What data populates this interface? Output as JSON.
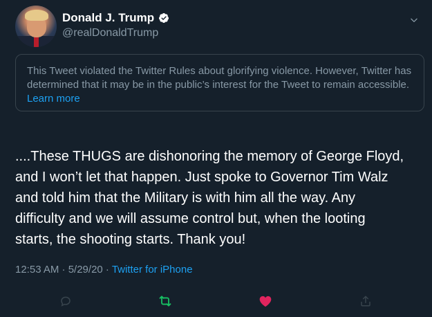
{
  "author": {
    "display_name": "Donald J. Trump",
    "handle": "@realDonaldTrump",
    "verified": true
  },
  "notice": {
    "text": "This Tweet violated the Twitter Rules about glorifying violence. However, Twitter has determined that it may be in the public’s interest for the Tweet to remain accessible. ",
    "link_label": "Learn more"
  },
  "tweet": {
    "text": "....These THUGS are dishonoring the memory of George Floyd,\nand I won’t let that happen. Just spoke to Governor Tim Walz\nand told him that the Military is with him all the way. Any\ndifficulty and we will assume control but, when the looting\nstarts, the shooting starts. Thank you!"
  },
  "meta": {
    "timestamp": "12:53 AM · 5/29/20 · ",
    "source": "Twitter for iPhone"
  },
  "colors": {
    "background": "#15202b",
    "text": "#ffffff",
    "secondary": "#8899a6",
    "accent": "#1da1f2",
    "retweet": "#17bf63",
    "like": "#e0245e",
    "border": "#38444d"
  },
  "icons": {
    "verified": "verified-badge-icon",
    "menu": "chevron-down-icon",
    "reply": "reply-icon",
    "retweet": "retweet-icon",
    "like": "heart-icon",
    "share": "share-icon"
  }
}
